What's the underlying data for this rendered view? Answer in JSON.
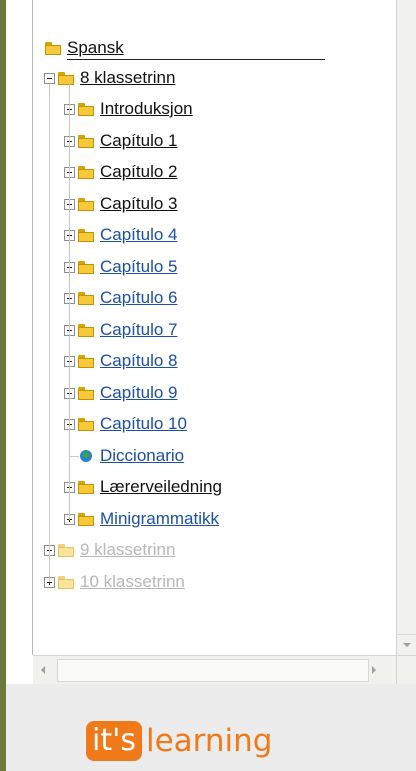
{
  "tree": {
    "root": {
      "label": "Spansk"
    },
    "level1": [
      {
        "label": "8 klassetrinn",
        "expanded": true,
        "color": "black",
        "children": [
          {
            "label": "Introduksjon",
            "type": "folder",
            "color": "black"
          },
          {
            "label": "Capítulo 1",
            "type": "folder",
            "color": "black"
          },
          {
            "label": "Capítulo 2",
            "type": "folder",
            "color": "black"
          },
          {
            "label": "Capítulo 3",
            "type": "folder",
            "color": "black"
          },
          {
            "label": "Capítulo 4",
            "type": "folder",
            "color": "blue"
          },
          {
            "label": "Capítulo 5",
            "type": "folder",
            "color": "blue"
          },
          {
            "label": "Capítulo 6",
            "type": "folder",
            "color": "blue"
          },
          {
            "label": "Capítulo 7",
            "type": "folder",
            "color": "blue"
          },
          {
            "label": "Capítulo 8",
            "type": "folder",
            "color": "blue"
          },
          {
            "label": "Capítulo 9",
            "type": "folder",
            "color": "blue"
          },
          {
            "label": "Capítulo 10",
            "type": "folder",
            "color": "blue"
          },
          {
            "label": "Diccionario",
            "type": "globe",
            "color": "blue"
          },
          {
            "label": "Lærerveiledning",
            "type": "folder",
            "color": "black"
          },
          {
            "label": "Minigrammatikk",
            "type": "folder",
            "color": "blue"
          }
        ]
      },
      {
        "label": "9 klassetrinn",
        "expanded": false,
        "color": "grey"
      },
      {
        "label": "10 klassetrinn",
        "expanded": false,
        "color": "grey"
      }
    ]
  },
  "logo": {
    "box_text": "it's",
    "text": "learning"
  },
  "colors": {
    "accent": "#f07a1a",
    "link_blue": "#1c4fa8",
    "folder": "#f6c83a",
    "disabled": "#b7b7b7"
  }
}
